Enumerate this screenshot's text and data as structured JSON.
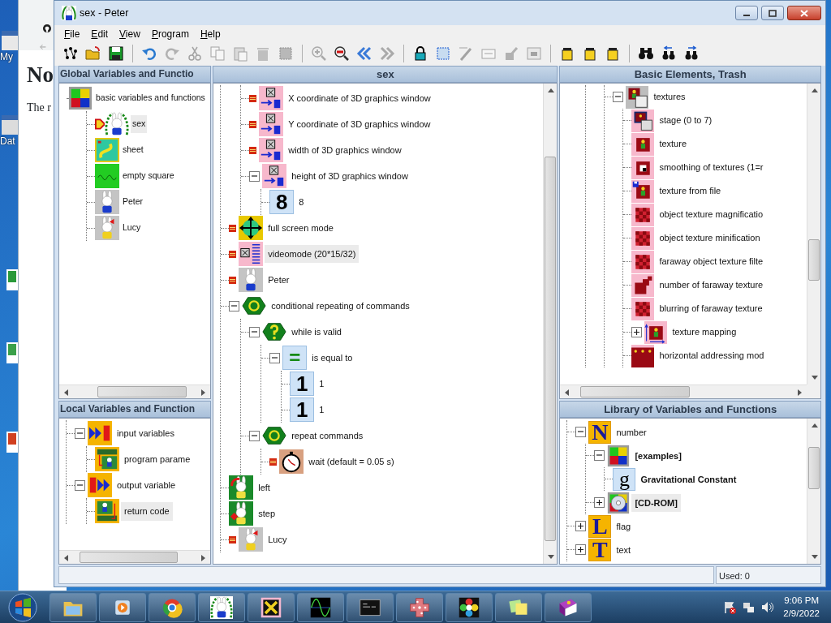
{
  "desktop": {
    "icons": [
      {
        "label": "My"
      },
      {
        "label": "Dat"
      }
    ]
  },
  "browser": {
    "heading": "No",
    "text": "The r"
  },
  "window": {
    "title": "sex - Peter"
  },
  "menu": [
    "File",
    "Edit",
    "View",
    "Program",
    "Help"
  ],
  "toolbar": [
    {
      "kind": "nodes",
      "disabled": false
    },
    {
      "kind": "open",
      "disabled": false
    },
    {
      "kind": "save",
      "disabled": false
    },
    {
      "kind": "separator"
    },
    {
      "kind": "undo",
      "disabled": false
    },
    {
      "kind": "redo",
      "disabled": true
    },
    {
      "kind": "cut",
      "disabled": true
    },
    {
      "kind": "copy",
      "disabled": true
    },
    {
      "kind": "paste",
      "disabled": true
    },
    {
      "kind": "trash",
      "disabled": true
    },
    {
      "kind": "select",
      "disabled": true
    },
    {
      "kind": "separator"
    },
    {
      "kind": "zoom-in",
      "disabled": true
    },
    {
      "kind": "zoom-out",
      "disabled": false
    },
    {
      "kind": "back",
      "disabled": false
    },
    {
      "kind": "forward",
      "disabled": true
    },
    {
      "kind": "separator"
    },
    {
      "kind": "lock",
      "disabled": false
    },
    {
      "kind": "frame",
      "disabled": false
    },
    {
      "kind": "text-pen",
      "disabled": true
    },
    {
      "kind": "text-box",
      "disabled": true
    },
    {
      "kind": "edit",
      "disabled": true
    },
    {
      "kind": "screen",
      "disabled": true
    },
    {
      "kind": "separator"
    },
    {
      "kind": "jar",
      "disabled": false
    },
    {
      "kind": "jar",
      "disabled": false
    },
    {
      "kind": "jar",
      "disabled": false
    },
    {
      "kind": "separator"
    },
    {
      "kind": "binoculars",
      "disabled": false
    },
    {
      "kind": "find-prev",
      "disabled": false
    },
    {
      "kind": "find-next",
      "disabled": false
    }
  ],
  "global_panel": {
    "title": "Global Variables and Functio",
    "tree": [
      {
        "label": "basic variables and functions",
        "kind": "palette",
        "selected": false,
        "children": [
          {
            "label": "sex",
            "kind": "ivy-rabbit",
            "selected": true,
            "pointer": true
          },
          {
            "label": "sheet",
            "kind": "map",
            "selected": false,
            "pointer": false
          },
          {
            "label": "empty square",
            "kind": "green-square",
            "selected": false,
            "pointer": false
          },
          {
            "label": "Peter",
            "kind": "rabbit",
            "selected": false,
            "pointer": false
          },
          {
            "label": "Lucy",
            "kind": "rabbit-bow",
            "selected": false,
            "pointer": false
          }
        ]
      }
    ]
  },
  "local_panel": {
    "title": "Local Variables and Function",
    "tree": [
      {
        "label": "input variables",
        "kind": "func-in",
        "expanded": true,
        "selected": false,
        "children": [
          {
            "label": "program parame",
            "kind": "param-in",
            "selected": false
          }
        ]
      },
      {
        "label": "output variable",
        "kind": "func-out",
        "expanded": true,
        "selected": false,
        "children": [
          {
            "label": "return code",
            "kind": "param-out",
            "selected": true
          }
        ]
      }
    ]
  },
  "main_panel": {
    "title": "sex",
    "tree": [
      {
        "children": [
          {
            "label": "X coordinate of 3D graphics window",
            "kind": "pink-window",
            "marker": true,
            "selected": false
          },
          {
            "label": "Y coordinate of 3D graphics window",
            "kind": "pink-window",
            "marker": true,
            "selected": false
          },
          {
            "label": "width of 3D graphics window",
            "kind": "pink-window",
            "marker": true,
            "selected": false
          },
          {
            "label": "height of 3D graphics window",
            "kind": "pink-window",
            "marker": false,
            "expanded": true,
            "selected": false,
            "children": [
              {
                "label": "8",
                "kind": "number-tile",
                "glyph": "8",
                "marker": false,
                "selected": false
              }
            ]
          }
        ]
      },
      {
        "label": "full screen mode",
        "kind": "move",
        "marker": true,
        "selected": false
      },
      {
        "label": "videomode (20*15/32)",
        "kind": "pink-list",
        "marker": true,
        "selected": true
      },
      {
        "label": "Peter",
        "kind": "rabbit",
        "marker": true,
        "selected": false
      },
      {
        "label": "conditional repeating of commands",
        "kind": "hex-loop",
        "marker": false,
        "expanded": true,
        "selected": false,
        "children": [
          {
            "label": "while is valid",
            "kind": "hex-question",
            "marker": false,
            "expanded": true,
            "selected": false,
            "children": [
              {
                "label": "is equal to",
                "kind": "sign-tile",
                "glyph": "=",
                "marker": false,
                "expanded": true,
                "selected": false,
                "children": [
                  {
                    "label": "1",
                    "kind": "number-tile",
                    "glyph": "1",
                    "marker": false,
                    "selected": false
                  },
                  {
                    "label": "1",
                    "kind": "number-tile",
                    "glyph": "1",
                    "marker": false,
                    "selected": false
                  }
                ]
              }
            ]
          },
          {
            "label": "repeat commands",
            "kind": "hex-loop",
            "marker": false,
            "expanded": true,
            "selected": false,
            "children": [
              {
                "label": "wait (default = 0.05 s)",
                "kind": "clock",
                "marker": true,
                "selected": false
              }
            ]
          }
        ]
      },
      {
        "label": "left",
        "kind": "green-rabbit",
        "marker": false,
        "selected": false
      },
      {
        "label": "step",
        "kind": "green-rabbit-dot",
        "marker": false,
        "selected": false
      },
      {
        "label": "Lucy",
        "kind": "rabbit-bow",
        "marker": true,
        "selected": false
      }
    ]
  },
  "elements_panel": {
    "title": "Basic Elements, Trash",
    "tree": [
      {
        "children": [
          {
            "children": [
              {
                "label": "textures",
                "kind": "grey-window",
                "expanded": true,
                "selected": false,
                "children": [
                  {
                    "label": "stage (0 to 7)",
                    "kind": "texture-window",
                    "selected": false
                  },
                  {
                    "label": "texture",
                    "kind": "texture",
                    "selected": false
                  },
                  {
                    "label": "smoothing of textures (1=r",
                    "kind": "texture-smooth",
                    "selected": false
                  },
                  {
                    "label": "texture from file",
                    "kind": "texture-file",
                    "selected": false
                  },
                  {
                    "label": "object texture magnificatio",
                    "kind": "checker",
                    "selected": false
                  },
                  {
                    "label": "object texture minification",
                    "kind": "checker",
                    "selected": false
                  },
                  {
                    "label": "faraway object texture filte",
                    "kind": "checker",
                    "selected": false
                  },
                  {
                    "label": "number of faraway texture",
                    "kind": "texture-number",
                    "selected": false
                  },
                  {
                    "label": "blurring of faraway texture",
                    "kind": "checker",
                    "selected": false
                  },
                  {
                    "label": "texture mapping",
                    "kind": "texture-map",
                    "expanded": false,
                    "selected": false
                  },
                  {
                    "label": "horizontal addressing mod",
                    "kind": "texture-row",
                    "selected": false
                  }
                ]
              }
            ]
          }
        ]
      }
    ]
  },
  "library_panel": {
    "title": "Library of Variables and Functions",
    "tree": [
      {
        "label": "number",
        "kind": "letter-tile",
        "glyph": "N",
        "expanded": true,
        "bold": false,
        "selected": false,
        "children": [
          {
            "label": "[examples]",
            "kind": "palette",
            "expanded": true,
            "bold": true,
            "selected": false,
            "children": [
              {
                "label": "Gravitational Constant",
                "kind": "serif-tile",
                "glyph": "g",
                "bold": true,
                "selected": false
              }
            ]
          },
          {
            "label": "[CD-ROM]",
            "kind": "cd",
            "expanded": false,
            "bold": true,
            "selected": true
          }
        ]
      },
      {
        "label": "flag",
        "kind": "letter-tile",
        "glyph": "L",
        "expanded": false,
        "bold": false,
        "selected": false
      },
      {
        "label": "text",
        "kind": "letter-tile",
        "glyph": "T",
        "expanded": false,
        "bold": false,
        "selected": false
      }
    ]
  },
  "status_bar": {
    "used": "Used: 0"
  },
  "taskbar": {
    "apps": [
      {
        "kind": "folder"
      },
      {
        "kind": "media"
      },
      {
        "kind": "browser"
      },
      {
        "kind": "rabbit"
      },
      {
        "kind": "cross"
      },
      {
        "kind": "wave"
      },
      {
        "kind": "terminal"
      },
      {
        "kind": "grid-cross"
      },
      {
        "kind": "flower"
      },
      {
        "kind": "notes"
      },
      {
        "kind": "book"
      }
    ],
    "time": "9:06 PM",
    "date": "2/9/2022"
  }
}
